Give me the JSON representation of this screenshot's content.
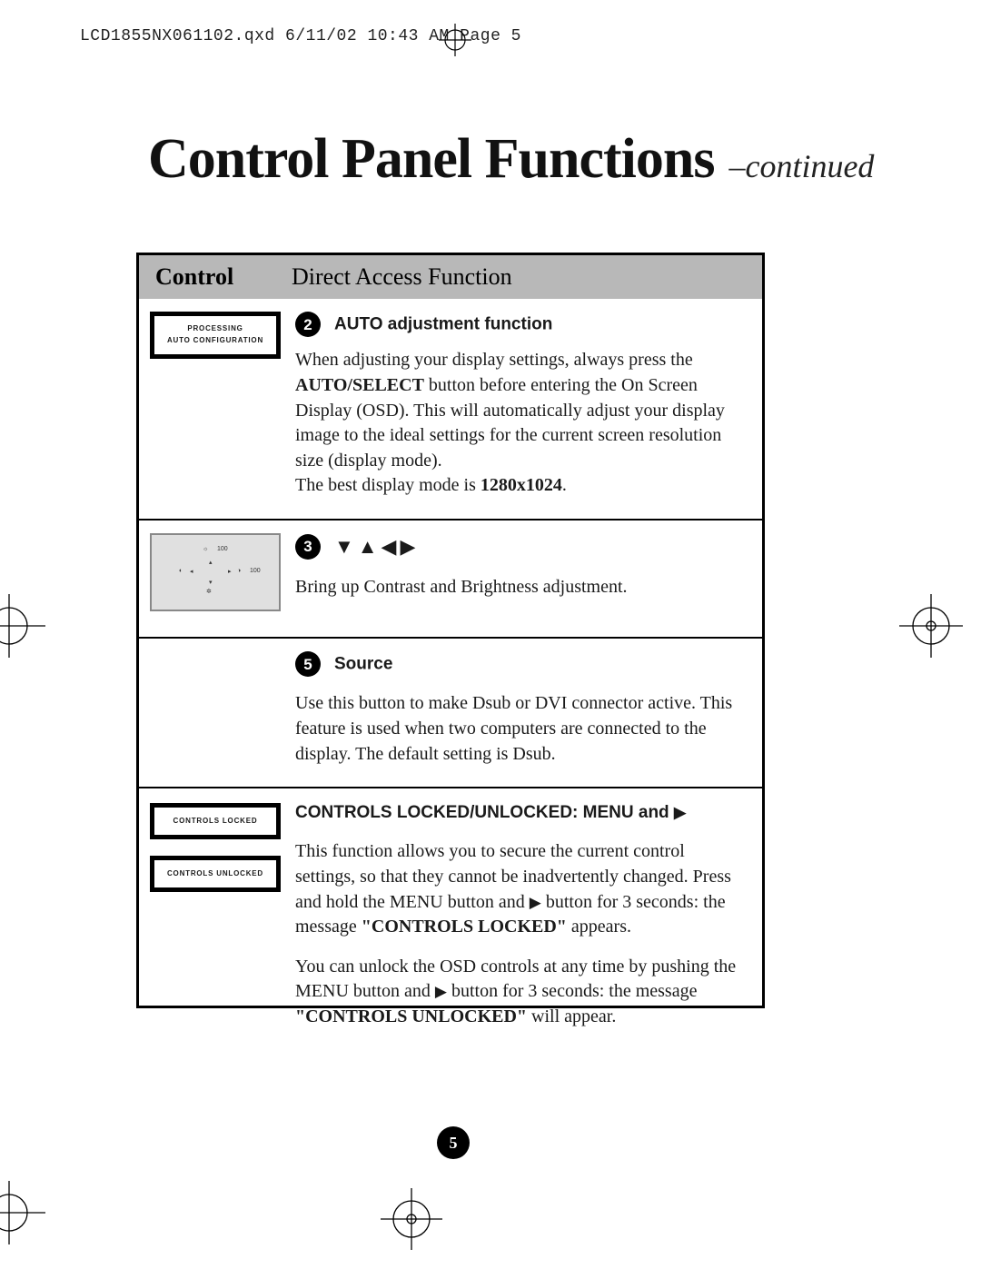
{
  "header": "LCD1855NX061102.qxd  6/11/02  10:43 AM  Page 5",
  "title_main": "Control Panel Functions",
  "title_sub": "–continued",
  "table": {
    "head_control": "Control",
    "head_function": "Direct Access Function"
  },
  "sec2": {
    "num": "2",
    "title": "AUTO adjustment function",
    "panel_line1": "PROCESSING",
    "panel_line2": "AUTO CONFIGURATION",
    "p1_a": "When adjusting your display settings, always press the ",
    "p1_bold": "AUTO/SELECT",
    "p1_b": " button before entering the On Screen Display (OSD). This will automatically adjust your display image to the ideal settings for the current screen resolution size (display mode).",
    "p2_a": "The best display mode is ",
    "p2_bold": "1280x1024",
    "p2_b": "."
  },
  "sec3": {
    "num": "3",
    "panel_n100a": "100",
    "panel_n100b": "100",
    "arrows": "▼▲◀▶",
    "p1": "Bring up Contrast and Brightness adjustment."
  },
  "sec5": {
    "num": "5",
    "title": "Source",
    "p1": "Use this button to make Dsub or DVI connector active. This fea­ture is used when two computers are connected to the display. The default setting is Dsub."
  },
  "sec_lock": {
    "title_a": "CONTROLS LOCKED/UNLOCKED: MENU and ",
    "title_arrow": "▶",
    "panel1": "CONTROLS LOCKED",
    "panel2": "CONTROLS UNLOCKED",
    "p1_a": "This function allows you to secure the current control settings, so that they cannot be inadvertently changed. Press and hold the MENU button and ",
    "p1_arrow": "▶",
    "p1_b": "button for 3 seconds: the message ",
    "p1_bold": "\"CONTROLS LOCKED\"",
    "p1_c": " appears.",
    "p2_a": "You can unlock the OSD controls at any time by pushing the MENU button and ",
    "p2_arrow": "▶",
    "p2_b": "button for 3 seconds: the message ",
    "p2_bold": "\"CONTROLS UNLOCKED\"",
    "p2_c": " will appear."
  },
  "page_number": "5"
}
